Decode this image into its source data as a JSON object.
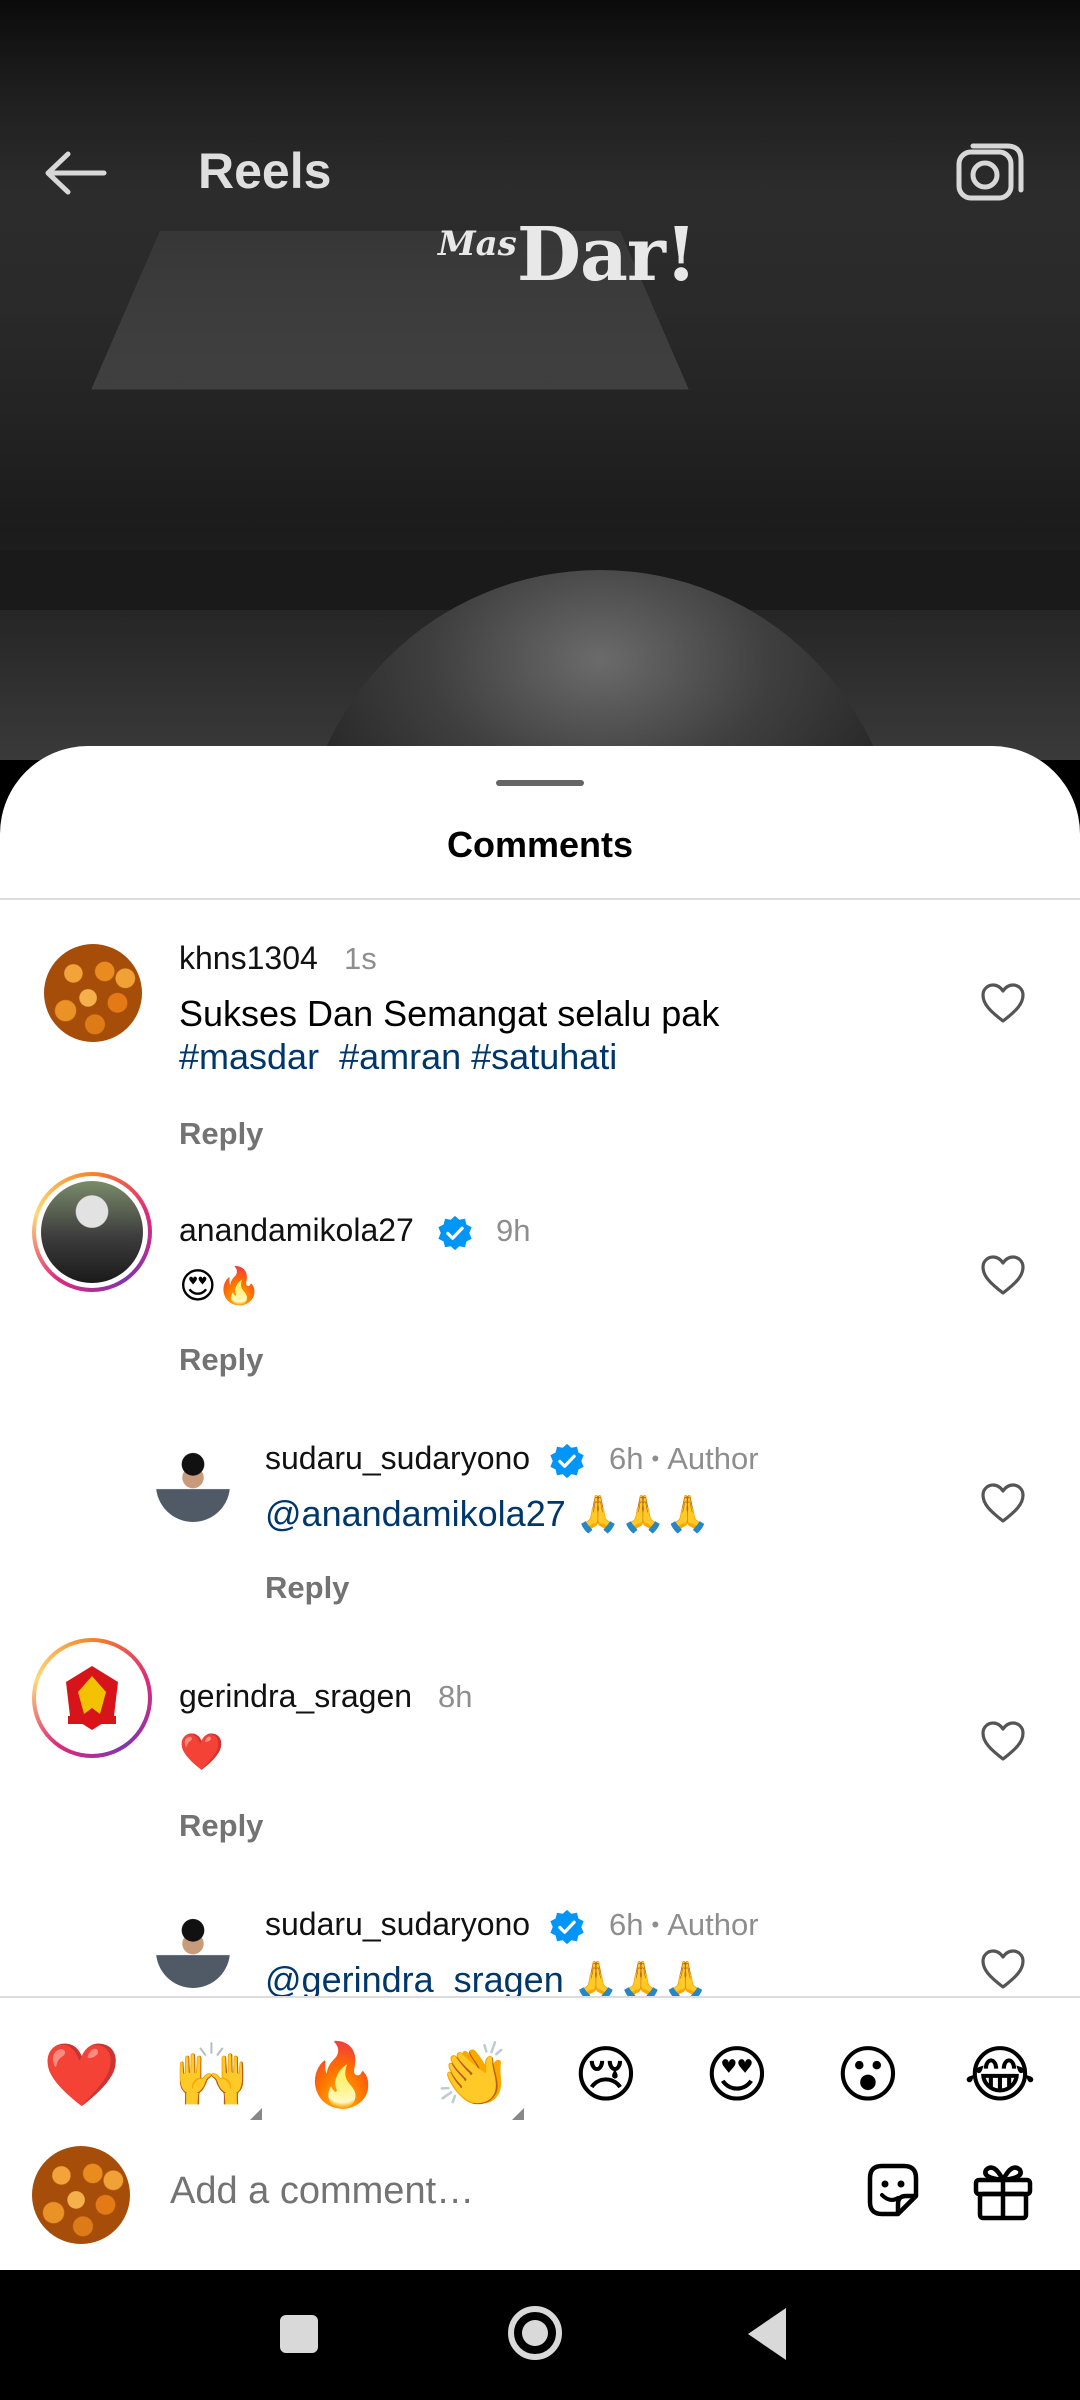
{
  "header": {
    "title": "Reels"
  },
  "watermark": {
    "prefix": "Mas",
    "main": "Dar!"
  },
  "sheet": {
    "title": "Comments"
  },
  "comments": [
    {
      "username": "khns1304",
      "time": "1s",
      "verified": false,
      "text": "Sukses Dan Semangat selalu pak",
      "tags": [
        "#masdar",
        "#amran",
        "#satuhati"
      ],
      "reply": "Reply"
    },
    {
      "username": "anandamikola27",
      "time": "9h",
      "verified": true,
      "text": "😍🔥",
      "reply": "Reply"
    },
    {
      "username": "sudaru_sudaryono",
      "time": "6h",
      "verified": true,
      "author_label": "Author",
      "mention": "@anandamikola27",
      "text": "🙏🙏🙏",
      "reply": "Reply"
    },
    {
      "username": "gerindra_sragen",
      "time": "8h",
      "verified": false,
      "text": "❤️",
      "reply": "Reply"
    },
    {
      "username": "sudaru_sudaryono",
      "time": "6h",
      "verified": true,
      "author_label": "Author",
      "mention": "@gerindra_sragen",
      "text": "🙏🙏🙏"
    }
  ],
  "reactions": [
    "❤️",
    "🙌",
    "🔥",
    "👏",
    "😢",
    "😍",
    "😮",
    "😂"
  ],
  "composer": {
    "placeholder": "Add a comment…"
  },
  "colors": {
    "verified": "#0095f6",
    "link": "#00376b",
    "secondary": "#8e8e8e"
  },
  "icons": [
    "back-arrow-icon",
    "camera-icon",
    "heart-icon",
    "verified-badge-icon",
    "sticker-icon",
    "gift-icon"
  ]
}
